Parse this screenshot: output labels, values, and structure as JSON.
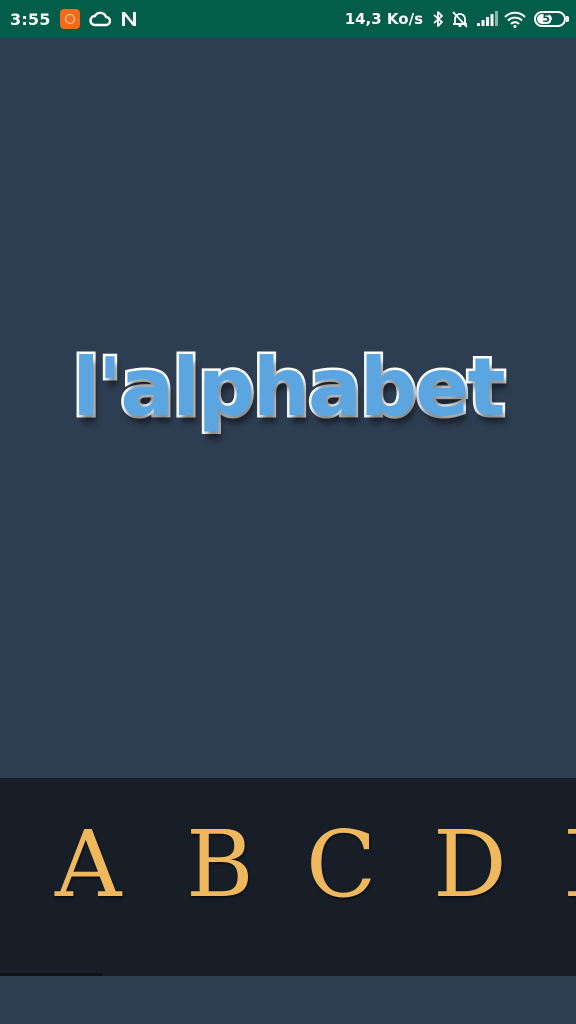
{
  "status_bar": {
    "time": "3:55",
    "network_speed": "14,3 Ko/s",
    "battery_level": "52",
    "icons": [
      "app-badge-icon",
      "cloud-icon",
      "n-logo-icon",
      "bluetooth-icon",
      "alarm-off-icon",
      "signal-icon",
      "wifi-icon",
      "battery-icon"
    ],
    "colors": {
      "background": "#045c4a",
      "app_badge": "#f26a1b"
    }
  },
  "main": {
    "title": "l'alphabet",
    "colors": {
      "background": "#2e3e52",
      "title_fill": "#5ba6e0",
      "title_outline": "#ffffff"
    }
  },
  "letters": {
    "items": [
      "A",
      "B",
      "C",
      "D",
      "E"
    ],
    "colors": {
      "background": "#171e27",
      "letter": "#f0b85c"
    }
  }
}
